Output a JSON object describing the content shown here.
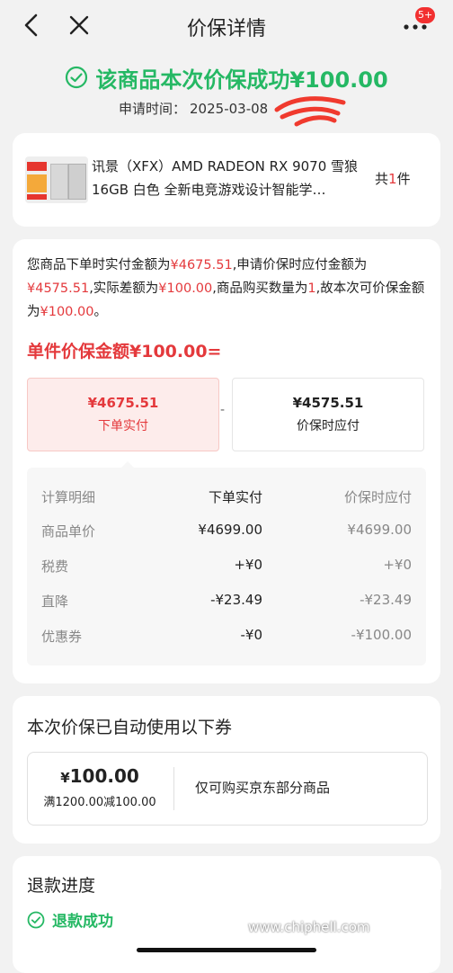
{
  "nav": {
    "title": "价保详情",
    "badge": "5+"
  },
  "status": {
    "success_text": "该商品本次价保成功¥100.00",
    "apply_time_label": "申请时间：",
    "apply_time_value": "2025-03-08"
  },
  "product": {
    "name": "讯景（XFX）AMD RADEON RX 9070 雪狼 16GB 白色 全新电竞游戏设计智能学…",
    "qty_prefix": "共",
    "qty_num": "1",
    "qty_suffix": "件"
  },
  "explanation": {
    "p1": "您商品下单时实付金额为",
    "v1": "¥4675.51",
    "p2": ",申请价保时应付金额为",
    "v2": "¥4575.51",
    "p3": ",实际差额为",
    "v3": "¥100.00",
    "p4": ",商品购买数量为",
    "v4": "1",
    "p5": ",故本次可价保金额为",
    "v5": "¥100.00",
    "p6": "。"
  },
  "single_amount": "单件价保金额¥100.00=",
  "box_order": {
    "amount": "¥4675.51",
    "label": "下单实付"
  },
  "minus_sign": "-",
  "box_protect": {
    "amount": "¥4575.51",
    "label": "价保时应付"
  },
  "calc": {
    "header": [
      "计算明细",
      "下单实付",
      "价保时应付"
    ],
    "rows": [
      [
        "商品单价",
        "¥4699.00",
        "¥4699.00"
      ],
      [
        "税费",
        "+¥0",
        "+¥0"
      ],
      [
        "直降",
        "-¥23.49",
        "-¥23.49"
      ],
      [
        "优惠券",
        "-¥0",
        "-¥100.00"
      ]
    ]
  },
  "coupon": {
    "title": "本次价保已自动使用以下券",
    "yen": "¥",
    "amount": "100.00",
    "condition": "满1200.00减100.00",
    "description": "仅可购买京东部分商品"
  },
  "refund": {
    "title": "退款进度",
    "status": "退款成功"
  },
  "watermark": {
    "url": "www.chiphell.com"
  },
  "colors": {
    "success_green": "#25b864",
    "price_red": "#e4393c",
    "badge_red": "#f23030"
  },
  "icons": [
    "back-arrow-icon",
    "close-icon",
    "more-icon",
    "check-circle-icon"
  ]
}
